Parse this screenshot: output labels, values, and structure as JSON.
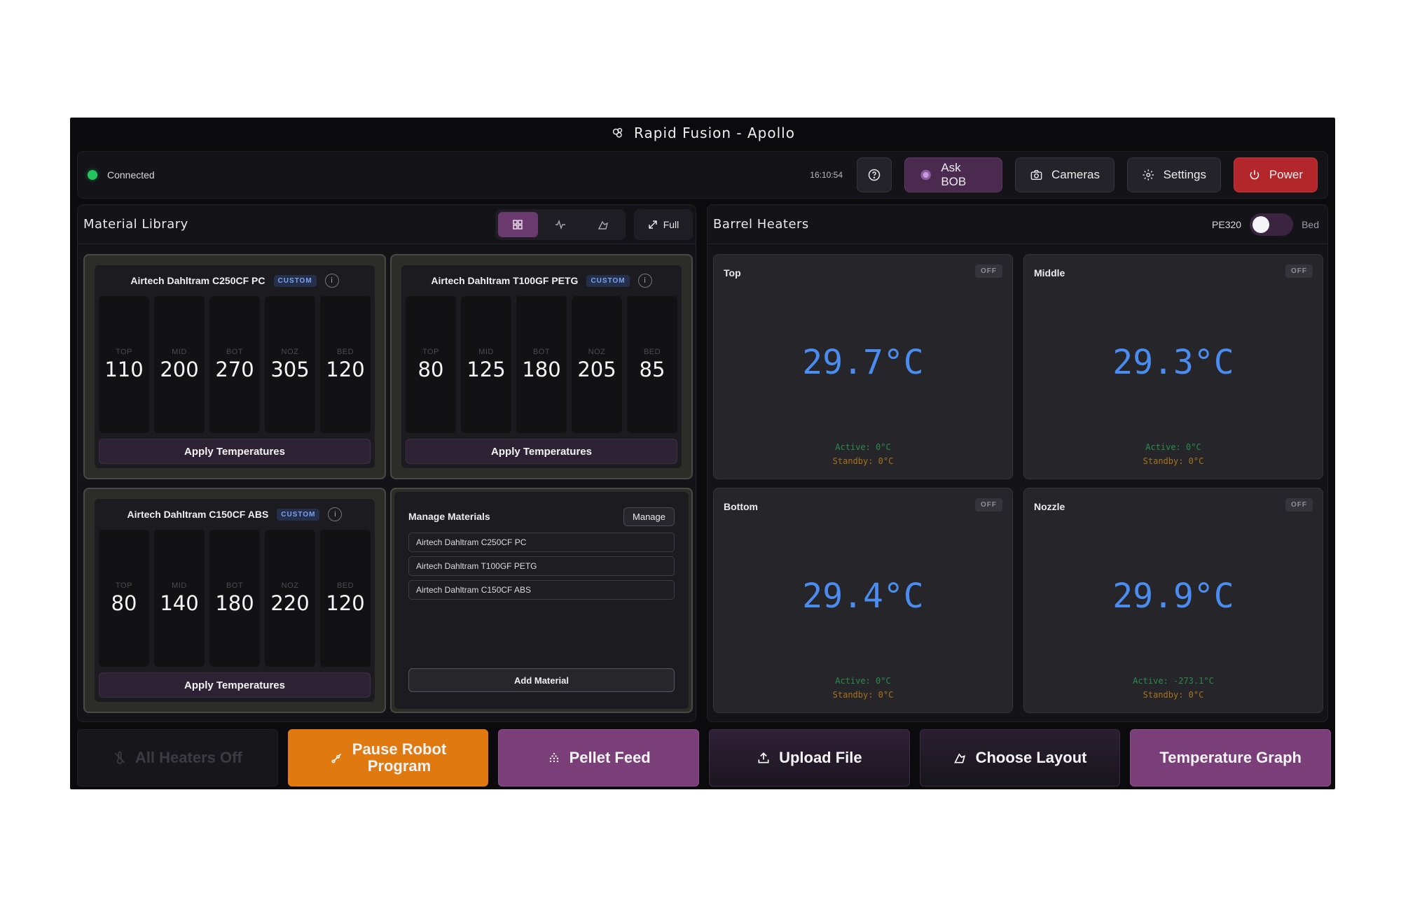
{
  "app": {
    "title": "Rapid Fusion - Apollo"
  },
  "topbar": {
    "status": "Connected",
    "status_color": "#22c55e",
    "time": "16:10:54",
    "help_icon": "question-circle-icon",
    "ask_bob": "Ask BOB",
    "cameras": "Cameras",
    "settings": "Settings",
    "power": "Power"
  },
  "material_library": {
    "title": "Material Library",
    "views": [
      "grid-icon",
      "activity-icon",
      "layout-icon"
    ],
    "active_view": "grid-icon",
    "full_label": "Full",
    "column_labels": [
      "TOP",
      "MID",
      "BOT",
      "NOZ",
      "BED"
    ],
    "apply_label": "Apply Temperatures",
    "cards": [
      {
        "name": "Airtech Dahltram C250CF PC",
        "badge": "CUSTOM",
        "values": [
          "110",
          "200",
          "270",
          "305",
          "120"
        ]
      },
      {
        "name": "Airtech Dahltram T100GF PETG",
        "badge": "CUSTOM",
        "values": [
          "80",
          "125",
          "180",
          "205",
          "85"
        ]
      },
      {
        "name": "Airtech Dahltram C150CF ABS",
        "badge": "CUSTOM",
        "values": [
          "80",
          "140",
          "180",
          "220",
          "120"
        ]
      }
    ],
    "manage": {
      "title": "Manage Materials",
      "button": "Manage",
      "items": [
        "Airtech Dahltram C250CF PC",
        "Airtech Dahltram T100GF PETG",
        "Airtech Dahltram C150CF ABS"
      ],
      "add_label": "Add Material"
    }
  },
  "barrel_heaters": {
    "title": "Barrel Heaters",
    "toggle_left": "PE320",
    "toggle_right": "Bed",
    "heaters": [
      {
        "name": "Top",
        "state": "OFF",
        "temp": "29.7°C",
        "active": "Active: 0°C",
        "standby": "Standby: 0°C"
      },
      {
        "name": "Middle",
        "state": "OFF",
        "temp": "29.3°C",
        "active": "Active: 0°C",
        "standby": "Standby: 0°C"
      },
      {
        "name": "Bottom",
        "state": "OFF",
        "temp": "29.4°C",
        "active": "Active: 0°C",
        "standby": "Standby: 0°C"
      },
      {
        "name": "Nozzle",
        "state": "OFF",
        "temp": "29.9°C",
        "active": "Active: -273.1°C",
        "standby": "Standby: 0°C"
      }
    ],
    "temp_color": "#4a8cf0"
  },
  "bottom": {
    "all_heaters_off": "All Heaters Off",
    "pause_line1": "Pause Robot",
    "pause_line2": "Program",
    "pellet_feed": "Pellet Feed",
    "upload_file": "Upload File",
    "choose_layout": "Choose Layout",
    "temperature_graph": "Temperature Graph",
    "pause_color": "#e07a10"
  }
}
